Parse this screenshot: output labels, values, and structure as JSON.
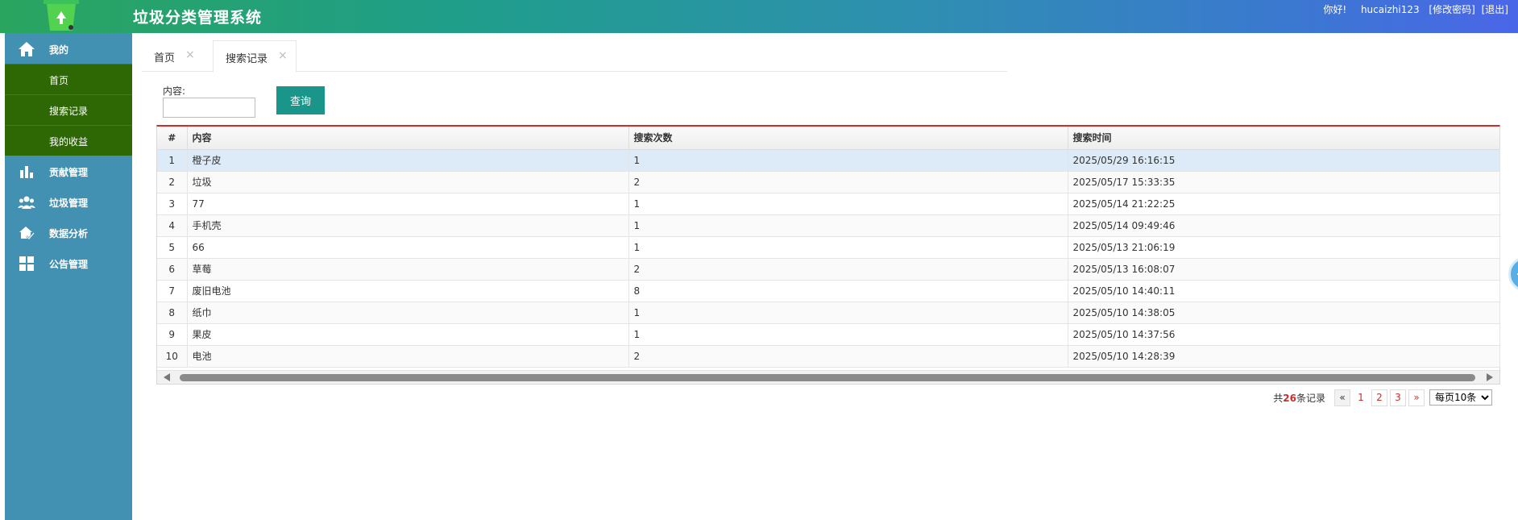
{
  "header": {
    "title": "垃圾分类管理系统",
    "greeting": "你好!",
    "username": "hucaizhi123",
    "change_password": "[修改密码]",
    "logout": "[退出]"
  },
  "sidebar": {
    "groups": [
      {
        "label": "我的",
        "icon": "home-icon"
      },
      {
        "label": "贡献管理",
        "icon": "bar-chart-icon"
      },
      {
        "label": "垃圾管理",
        "icon": "users-icon"
      },
      {
        "label": "数据分析",
        "icon": "analysis-icon"
      },
      {
        "label": "公告管理",
        "icon": "grid-icon"
      }
    ],
    "sub_items": [
      {
        "label": "首页"
      },
      {
        "label": "搜索记录"
      },
      {
        "label": "我的收益"
      }
    ]
  },
  "tabs": [
    {
      "label": "首页",
      "active": false
    },
    {
      "label": "搜索记录",
      "active": true
    }
  ],
  "search": {
    "label": "内容:",
    "value": "",
    "button": "查询"
  },
  "table": {
    "headers": [
      "#",
      "内容",
      "搜索次数",
      "搜索时间"
    ],
    "rows": [
      [
        "1",
        "橙子皮",
        "1",
        "2025/05/29 16:16:15"
      ],
      [
        "2",
        "垃圾",
        "2",
        "2025/05/17 15:33:35"
      ],
      [
        "3",
        "77",
        "1",
        "2025/05/14 21:22:25"
      ],
      [
        "4",
        "手机壳",
        "1",
        "2025/05/14 09:49:46"
      ],
      [
        "5",
        "66",
        "1",
        "2025/05/13 21:06:19"
      ],
      [
        "6",
        "草莓",
        "2",
        "2025/05/13 16:08:07"
      ],
      [
        "7",
        "废旧电池",
        "8",
        "2025/05/10 14:40:11"
      ],
      [
        "8",
        "纸巾",
        "1",
        "2025/05/10 14:38:05"
      ],
      [
        "9",
        "果皮",
        "1",
        "2025/05/10 14:37:56"
      ],
      [
        "10",
        "电池",
        "2",
        "2025/05/10 14:28:39"
      ]
    ]
  },
  "pager": {
    "total_prefix": "共",
    "total_count": "26",
    "total_suffix": "条记录",
    "prev": "«",
    "pages": [
      "1",
      "2",
      "3"
    ],
    "current_page": "1",
    "next": "»",
    "per_page": "每页10条"
  },
  "colors": {
    "header_gradient_start": "#2aa55f",
    "header_gradient_end": "#4a66e8",
    "sidebar": "#4290b2",
    "sidebar_sub": "#2e6805",
    "primary_button": "#1a9589",
    "accent_red": "#c9302c"
  }
}
